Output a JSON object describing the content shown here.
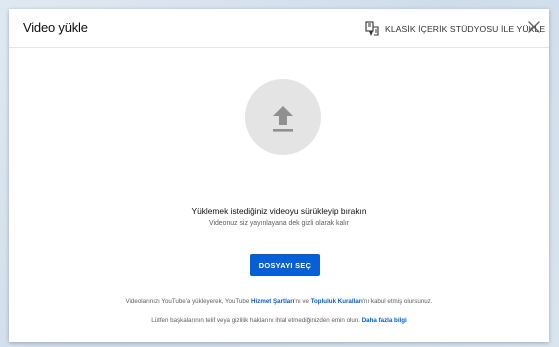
{
  "dialog": {
    "title": "Video yükle",
    "classic_studio_label": "KLASİK İÇERİK STÜDYOSU İLE YÜKLE",
    "close_icon": "close-icon"
  },
  "upload": {
    "icon": "upload-arrow-icon",
    "title": "Yüklemek istediğiniz videoyu sürükleyip bırakın",
    "subtitle": "Videonuz siz yayınlayana dek gizli olarak kalır",
    "select_button": "DOSYAYI SEÇ"
  },
  "footer": {
    "line1_part1": "Videolarınızı YouTube'a yükleyerek, YouTube ",
    "terms_link": "Hizmet Şartları",
    "line1_part2": "'nı ve ",
    "guidelines_link": "Topluluk Kuralları",
    "line1_part3": "'nı kabul etmiş olursunuz.",
    "line2_part1": "Lütfen başkalarının telif veya gizlilik haklarını ihlal etmediğinizden emin olun. ",
    "learn_more_link": "Daha fazla bilgi"
  },
  "colors": {
    "accent": "#065fd4",
    "circle": "#e4e4e4",
    "icon": "#909090"
  }
}
